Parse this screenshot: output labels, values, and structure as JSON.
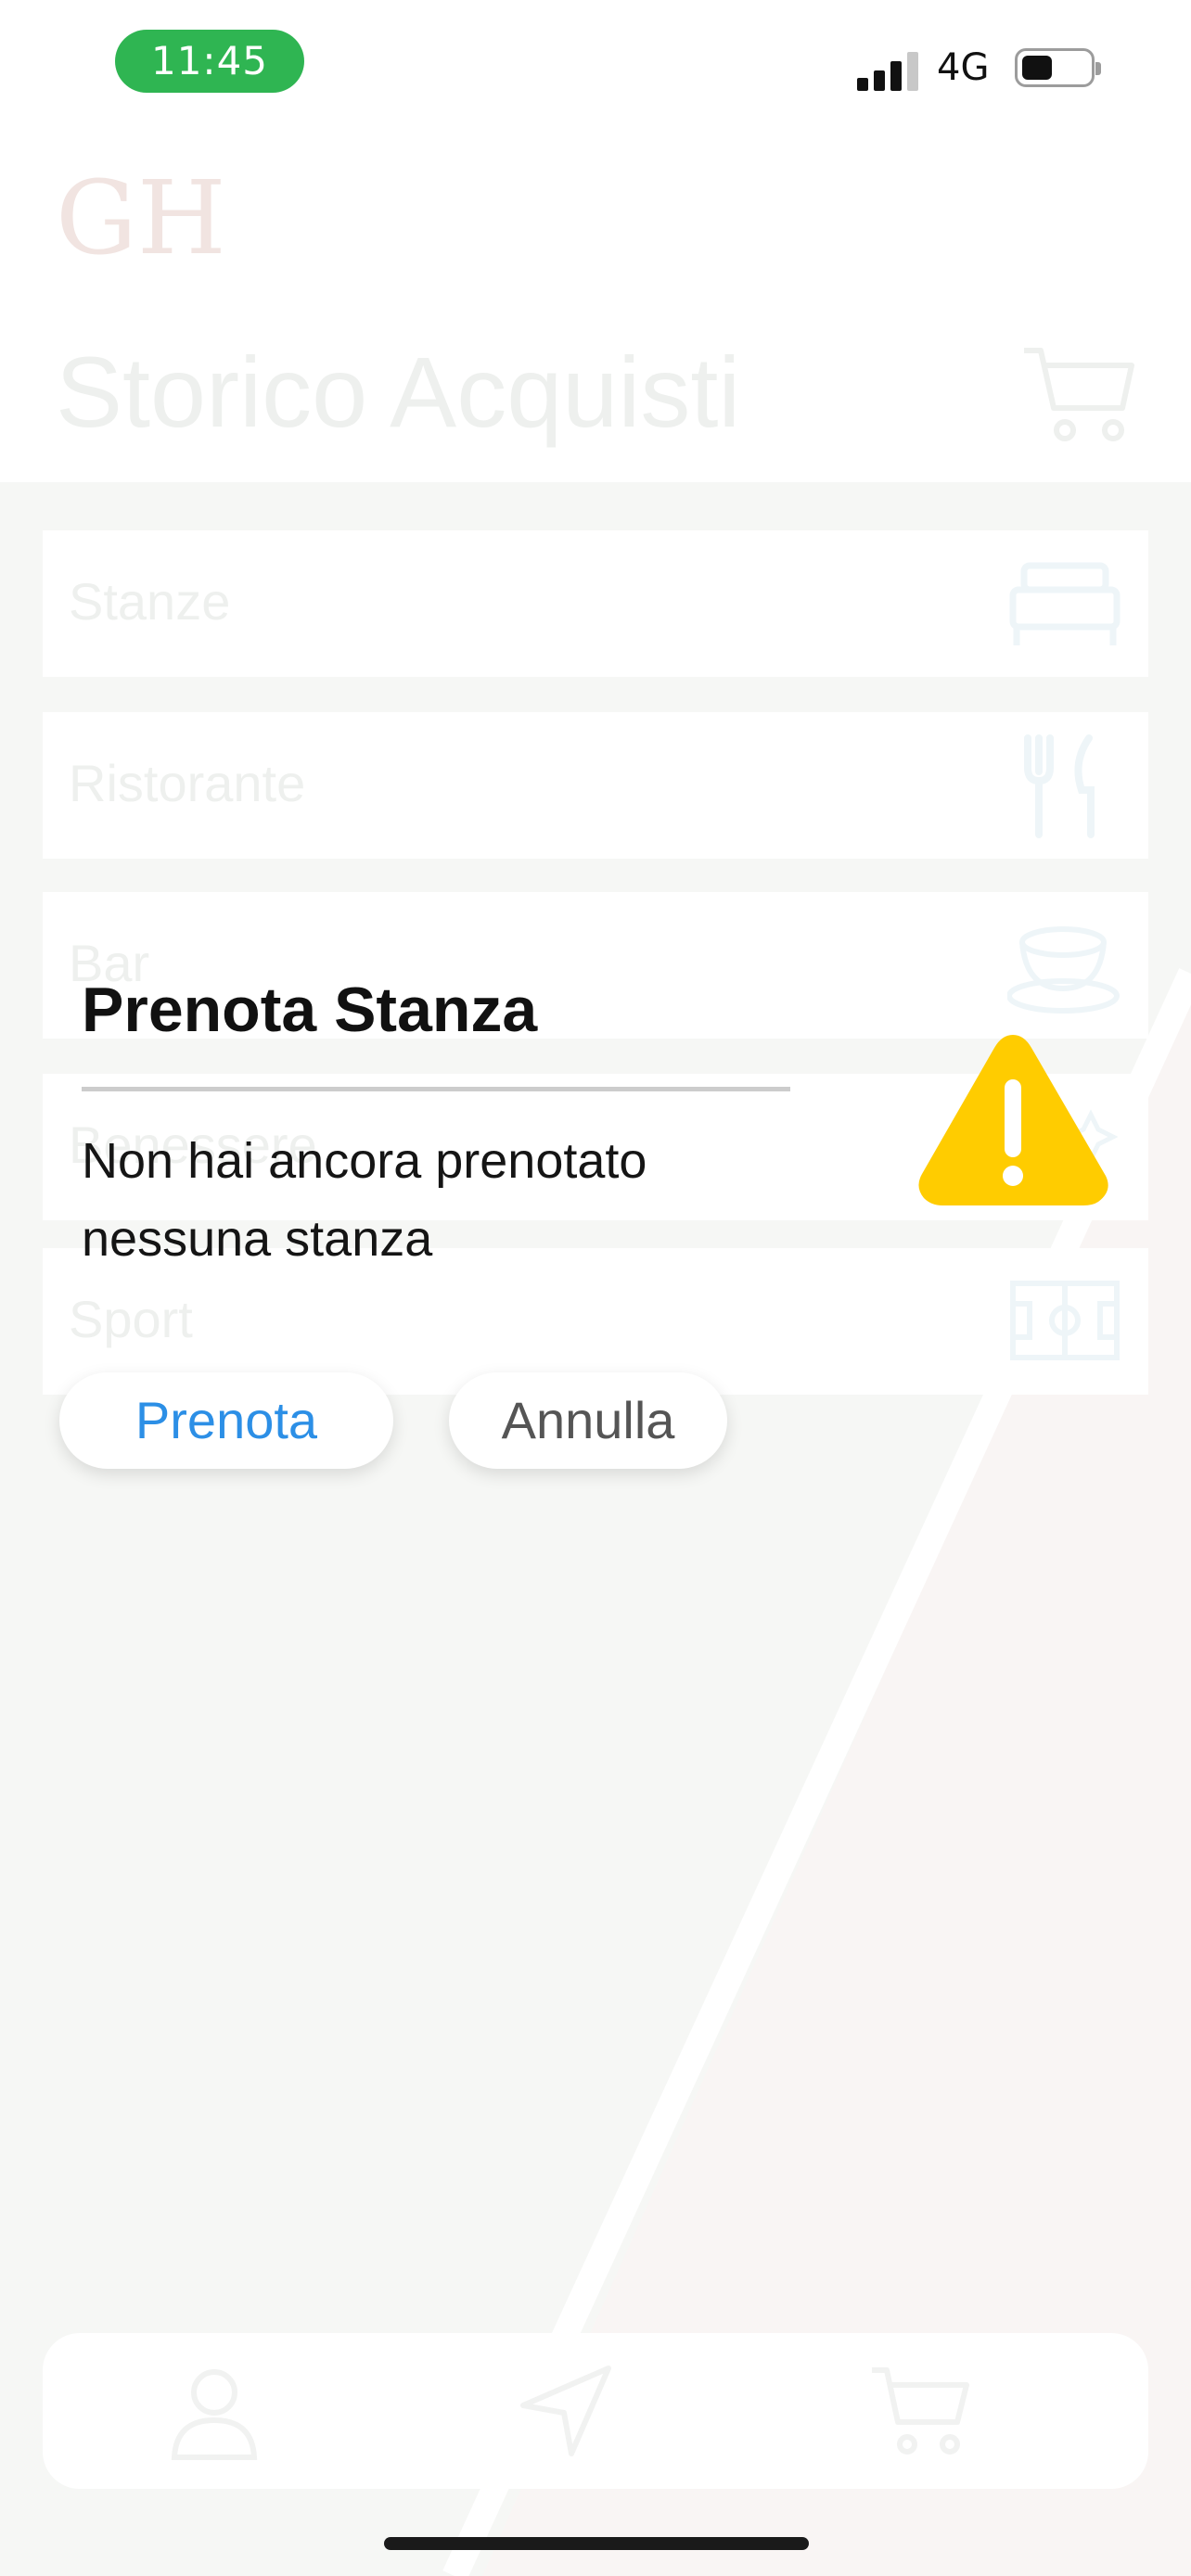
{
  "status_bar": {
    "time": "11:45",
    "network": "4G"
  },
  "header": {
    "logo_text": "GH",
    "title": "Storico Acquisti"
  },
  "categories": [
    {
      "label": "Stanze",
      "icon": "bed-icon"
    },
    {
      "label": "Ristorante",
      "icon": "cutlery-icon"
    },
    {
      "label": "Bar",
      "icon": "coffee-cup-icon"
    },
    {
      "label": "Benessere",
      "icon": "spa-icon"
    },
    {
      "label": "Sport",
      "icon": "field-icon"
    }
  ],
  "alert": {
    "title": "Prenota Stanza",
    "message": "Non hai ancora prenotato nessuna stanza",
    "icon": "warning-icon",
    "confirm_label": "Prenota",
    "cancel_label": "Annulla"
  },
  "bottom_nav": [
    {
      "icon": "user-icon"
    },
    {
      "icon": "navigation-icon"
    },
    {
      "icon": "cart-icon"
    }
  ],
  "colors": {
    "status_pill": "#2fb552",
    "warning": "#ffcc00",
    "link_blue": "#2c8fe6"
  }
}
